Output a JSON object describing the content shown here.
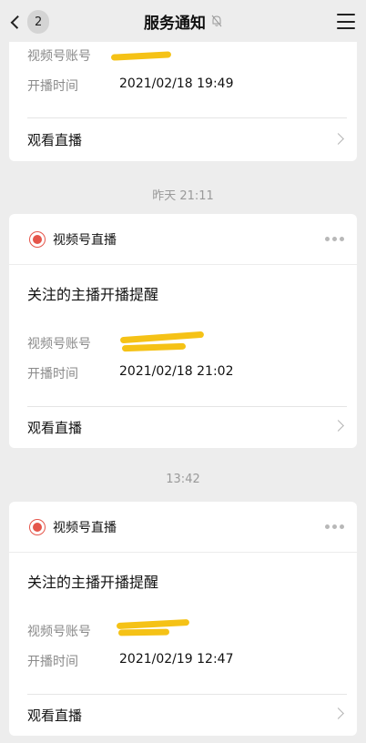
{
  "nav": {
    "title": "服务通知",
    "unread_count": "2",
    "icons": {
      "back": "chevron-left-icon",
      "mute": "bell-off-icon",
      "menu": "hamburger-menu-icon"
    }
  },
  "colors": {
    "accent_red": "#e5554a",
    "redaction_yellow": "#f5c216",
    "background": "#ededed"
  },
  "messages": [
    {
      "account_label": "视频号账号",
      "start_label": "开播时间",
      "start_time": "2021/02/18 19:49",
      "watch_label": "观看直播"
    },
    {
      "timestamp": "昨天 21:11",
      "source": "视频号直播",
      "title": "关注的主播开播提醒",
      "account_label": "视频号账号",
      "start_label": "开播时间",
      "start_time": "2021/02/18 21:02",
      "watch_label": "观看直播"
    },
    {
      "timestamp": "13:42",
      "source": "视频号直播",
      "title": "关注的主播开播提醒",
      "account_label": "视频号账号",
      "start_label": "开播时间",
      "start_time": "2021/02/19 12:47",
      "watch_label": "观看直播"
    }
  ]
}
